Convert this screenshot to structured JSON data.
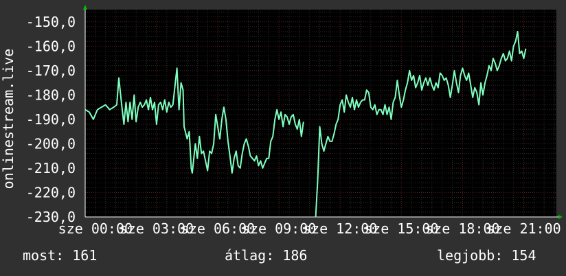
{
  "chart_data": {
    "type": "line",
    "title": "",
    "xlabel": "",
    "ylabel": "onlinestream.live",
    "ylim": [
      -230,
      -145
    ],
    "xlim": [
      -0.5,
      22.6
    ],
    "yticks": [
      {
        "value": -150,
        "label": "-150,0"
      },
      {
        "value": -160,
        "label": "-160,0"
      },
      {
        "value": -170,
        "label": "-170,0"
      },
      {
        "value": -180,
        "label": "-180,0"
      },
      {
        "value": -190,
        "label": "-190,0"
      },
      {
        "value": -200,
        "label": "-200,0"
      },
      {
        "value": -210,
        "label": "-210,0"
      },
      {
        "value": -220,
        "label": "-220,0"
      },
      {
        "value": -230,
        "label": "-230,0"
      }
    ],
    "xticks": [
      {
        "value": 0,
        "label": "sze 00:00"
      },
      {
        "value": 3,
        "label": "sze 03:00"
      },
      {
        "value": 6,
        "label": "sze 06:00"
      },
      {
        "value": 9,
        "label": "sze 09:00"
      },
      {
        "value": 12,
        "label": "sze 12:00"
      },
      {
        "value": 15,
        "label": "sze 15:00"
      },
      {
        "value": 18,
        "label": "sze 18:00"
      },
      {
        "value": 21,
        "label": "sze 21:00"
      }
    ],
    "grid": true,
    "series": [
      {
        "color": "#7fffbf",
        "segments": [
          [
            [
              -0.5,
              -186
            ],
            [
              -0.3,
              -187
            ],
            [
              -0.1,
              -190
            ],
            [
              0.1,
              -186
            ],
            [
              0.3,
              -185
            ],
            [
              0.5,
              -184
            ],
            [
              0.7,
              -186
            ],
            [
              0.9,
              -185
            ],
            [
              1.05,
              -184
            ],
            [
              1.15,
              -173
            ],
            [
              1.3,
              -185
            ],
            [
              1.4,
              -192
            ],
            [
              1.5,
              -183
            ],
            [
              1.6,
              -191
            ],
            [
              1.7,
              -183
            ],
            [
              1.8,
              -190
            ],
            [
              1.9,
              -180
            ],
            [
              2.0,
              -191
            ],
            [
              2.1,
              -185
            ],
            [
              2.2,
              -183
            ],
            [
              2.3,
              -185
            ],
            [
              2.4,
              -184
            ],
            [
              2.5,
              -182
            ],
            [
              2.6,
              -186
            ],
            [
              2.7,
              -181
            ],
            [
              2.8,
              -186
            ],
            [
              2.9,
              -183
            ],
            [
              3.0,
              -192
            ],
            [
              3.1,
              -184
            ],
            [
              3.2,
              -183
            ],
            [
              3.3,
              -186
            ],
            [
              3.4,
              -182
            ],
            [
              3.5,
              -187
            ],
            [
              3.6,
              -183
            ],
            [
              3.7,
              -185
            ],
            [
              3.8,
              -184
            ],
            [
              4.0,
              -169
            ],
            [
              4.1,
              -186
            ],
            [
              4.2,
              -175
            ],
            [
              4.3,
              -178
            ],
            [
              4.35,
              -193
            ],
            [
              4.5,
              -198
            ],
            [
              4.6,
              -195
            ],
            [
              4.7,
              -210
            ],
            [
              4.75,
              -212
            ],
            [
              4.9,
              -200
            ],
            [
              5.0,
              -206
            ],
            [
              5.1,
              -197
            ],
            [
              5.2,
              -204
            ],
            [
              5.3,
              -203
            ],
            [
              5.4,
              -207
            ],
            [
              5.5,
              -211
            ],
            [
              5.6,
              -203
            ],
            [
              5.7,
              -204
            ],
            [
              5.8,
              -200
            ],
            [
              5.9,
              -188
            ],
            [
              6.0,
              -193
            ],
            [
              6.1,
              -198
            ],
            [
              6.2,
              -190
            ],
            [
              6.3,
              -185
            ],
            [
              6.4,
              -190
            ],
            [
              6.5,
              -199
            ],
            [
              6.6,
              -205
            ],
            [
              6.7,
              -212
            ],
            [
              6.8,
              -206
            ],
            [
              6.9,
              -203
            ],
            [
              7.0,
              -209
            ],
            [
              7.1,
              -210
            ],
            [
              7.2,
              -204
            ],
            [
              7.3,
              -200
            ],
            [
              7.4,
              -198
            ],
            [
              7.5,
              -201
            ],
            [
              7.6,
              -205
            ],
            [
              7.7,
              -206
            ],
            [
              7.8,
              -207
            ],
            [
              7.9,
              -205
            ],
            [
              8.0,
              -209
            ],
            [
              8.1,
              -207
            ],
            [
              8.2,
              -210
            ],
            [
              8.3,
              -208
            ],
            [
              8.4,
              -206
            ],
            [
              8.5,
              -206
            ],
            [
              8.6,
              -199
            ],
            [
              8.7,
              -197
            ],
            [
              8.8,
              -190
            ],
            [
              8.9,
              -186
            ],
            [
              9.0,
              -190
            ],
            [
              9.1,
              -187
            ],
            [
              9.2,
              -193
            ],
            [
              9.3,
              -188
            ],
            [
              9.4,
              -189
            ],
            [
              9.5,
              -192
            ],
            [
              9.6,
              -189
            ],
            [
              9.7,
              -188
            ],
            [
              9.8,
              -192
            ],
            [
              9.9,
              -194
            ],
            [
              10.0,
              -190
            ],
            [
              10.1,
              -197
            ],
            [
              10.2,
              -191
            ]
          ],
          [
            [
              10.8,
              -230.5
            ],
            [
              10.9,
              -215
            ],
            [
              11.0,
              -193
            ],
            [
              11.1,
              -200
            ],
            [
              11.2,
              -203
            ],
            [
              11.3,
              -200
            ],
            [
              11.4,
              -197
            ],
            [
              11.5,
              -199
            ],
            [
              11.6,
              -199
            ],
            [
              11.7,
              -196
            ],
            [
              11.8,
              -192
            ],
            [
              11.9,
              -190
            ],
            [
              12.0,
              -184
            ],
            [
              12.1,
              -182
            ],
            [
              12.2,
              -187
            ],
            [
              12.3,
              -180
            ],
            [
              12.4,
              -183
            ],
            [
              12.5,
              -185
            ],
            [
              12.6,
              -181
            ],
            [
              12.7,
              -186
            ],
            [
              12.8,
              -182
            ],
            [
              12.9,
              -185
            ],
            [
              13.0,
              -183
            ],
            [
              13.1,
              -182
            ],
            [
              13.2,
              -182
            ],
            [
              13.3,
              -178
            ],
            [
              13.4,
              -179
            ],
            [
              13.5,
              -185
            ],
            [
              13.6,
              -186
            ],
            [
              13.7,
              -184
            ],
            [
              13.8,
              -188
            ],
            [
              13.9,
              -186
            ],
            [
              14.0,
              -186
            ],
            [
              14.1,
              -188
            ],
            [
              14.2,
              -184
            ],
            [
              14.3,
              -188
            ],
            [
              14.4,
              -185
            ],
            [
              14.5,
              -190
            ],
            [
              14.6,
              -183
            ],
            [
              14.7,
              -181
            ],
            [
              14.8,
              -174
            ],
            [
              14.9,
              -180
            ],
            [
              15.0,
              -185
            ],
            [
              15.1,
              -182
            ],
            [
              15.2,
              -178
            ],
            [
              15.3,
              -175
            ],
            [
              15.4,
              -170
            ],
            [
              15.5,
              -174
            ],
            [
              15.6,
              -172
            ],
            [
              15.7,
              -177
            ],
            [
              15.8,
              -175
            ],
            [
              15.9,
              -172
            ],
            [
              16.0,
              -178
            ],
            [
              16.1,
              -175
            ],
            [
              16.2,
              -173
            ],
            [
              16.3,
              -176
            ],
            [
              16.4,
              -173
            ],
            [
              16.5,
              -176
            ],
            [
              16.6,
              -178
            ],
            [
              16.7,
              -175
            ],
            [
              16.8,
              -177
            ],
            [
              16.9,
              -171
            ],
            [
              17.0,
              -172
            ],
            [
              17.1,
              -174
            ],
            [
              17.2,
              -173
            ],
            [
              17.3,
              -176
            ],
            [
              17.4,
              -181
            ],
            [
              17.5,
              -176
            ],
            [
              17.6,
              -170
            ],
            [
              17.7,
              -175
            ],
            [
              17.8,
              -179
            ],
            [
              17.9,
              -172
            ],
            [
              18.0,
              -169
            ],
            [
              18.1,
              -172
            ],
            [
              18.2,
              -174
            ],
            [
              18.3,
              -171
            ],
            [
              18.4,
              -176
            ],
            [
              18.5,
              -181
            ],
            [
              18.6,
              -177
            ],
            [
              18.7,
              -179
            ],
            [
              18.8,
              -184
            ],
            [
              18.9,
              -175
            ],
            [
              19.0,
              -180
            ],
            [
              19.1,
              -175
            ],
            [
              19.2,
              -172
            ],
            [
              19.3,
              -168
            ],
            [
              19.4,
              -170
            ],
            [
              19.5,
              -165
            ],
            [
              19.6,
              -167
            ],
            [
              19.7,
              -170
            ],
            [
              19.8,
              -168
            ],
            [
              19.9,
              -165
            ],
            [
              20.0,
              -163
            ],
            [
              20.1,
              -166
            ],
            [
              20.2,
              -165
            ],
            [
              20.3,
              -162
            ],
            [
              20.4,
              -166
            ],
            [
              20.5,
              -160
            ],
            [
              20.6,
              -158
            ],
            [
              20.7,
              -154
            ],
            [
              20.8,
              -163
            ],
            [
              20.9,
              -162
            ],
            [
              21.0,
              -165
            ],
            [
              21.1,
              -161
            ]
          ]
        ]
      }
    ]
  },
  "footer": {
    "now": "most: 161",
    "avg": "átlag: 186",
    "best": "legjobb: 154"
  },
  "colors": {
    "background": "#303030",
    "plot_background": "#000000",
    "grid_major": "#5a1f1f",
    "grid_minor": "#2c2c2c",
    "axis": "#ffffff",
    "arrow": "#00c000",
    "line": "#7fffbf"
  }
}
